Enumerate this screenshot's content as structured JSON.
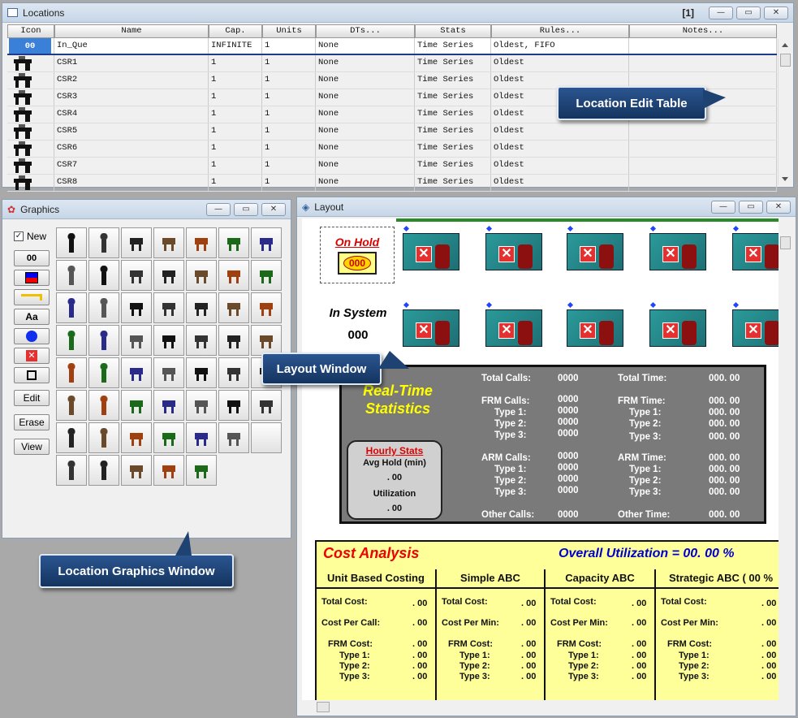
{
  "locations": {
    "title": "Locations",
    "marker": "[1]",
    "columns": [
      "Icon",
      "Name",
      "Cap.",
      "Units",
      "DTs...",
      "Stats",
      "Rules...",
      "Notes..."
    ],
    "rows": [
      {
        "icon": "00",
        "name": "In_Que",
        "cap": "INFINITE",
        "units": "1",
        "dts": "None",
        "stats": "Time Series",
        "rules": "Oldest, FIFO",
        "notes": ""
      },
      {
        "icon": "",
        "name": "CSR1",
        "cap": "1",
        "units": "1",
        "dts": "None",
        "stats": "Time Series",
        "rules": "Oldest",
        "notes": ""
      },
      {
        "icon": "",
        "name": "CSR2",
        "cap": "1",
        "units": "1",
        "dts": "None",
        "stats": "Time Series",
        "rules": "Oldest",
        "notes": ""
      },
      {
        "icon": "",
        "name": "CSR3",
        "cap": "1",
        "units": "1",
        "dts": "None",
        "stats": "Time Series",
        "rules": "Oldest",
        "notes": ""
      },
      {
        "icon": "",
        "name": "CSR4",
        "cap": "1",
        "units": "1",
        "dts": "None",
        "stats": "Time Series",
        "rules": "Oldest",
        "notes": ""
      },
      {
        "icon": "",
        "name": "CSR5",
        "cap": "1",
        "units": "1",
        "dts": "None",
        "stats": "Time Series",
        "rules": "Oldest",
        "notes": ""
      },
      {
        "icon": "",
        "name": "CSR6",
        "cap": "1",
        "units": "1",
        "dts": "None",
        "stats": "Time Series",
        "rules": "Oldest",
        "notes": ""
      },
      {
        "icon": "",
        "name": "CSR7",
        "cap": "1",
        "units": "1",
        "dts": "None",
        "stats": "Time Series",
        "rules": "Oldest",
        "notes": ""
      },
      {
        "icon": "",
        "name": "CSR8",
        "cap": "1",
        "units": "1",
        "dts": "None",
        "stats": "Time Series",
        "rules": "Oldest",
        "notes": ""
      }
    ]
  },
  "graphics": {
    "title": "Graphics",
    "new_label": "New",
    "oo_label": "00",
    "aa_label": "Aa",
    "edit_label": "Edit",
    "erase_label": "Erase",
    "view_label": "View"
  },
  "layout": {
    "title": "Layout",
    "on_hold_label": "On Hold",
    "on_hold_value": "000",
    "in_system_label": "In System",
    "in_system_value": "000",
    "rts": {
      "title_line1": "Real-Time",
      "title_line2": "Statistics",
      "total_calls": "Total Calls:",
      "total_calls_v": "0000",
      "total_time": "Total Time:",
      "total_time_v": "000. 00",
      "frm_calls": "FRM Calls:",
      "frm_calls_v": "0000",
      "frm_time": "FRM Time:",
      "frm_time_v": "000. 00",
      "type1": "Type 1:",
      "type2": "Type 2:",
      "type3": "Type 3:",
      "zero4": "0000",
      "zero_t": "000. 00",
      "arm_calls": "ARM Calls:",
      "arm_calls_v": "0000",
      "arm_time": "ARM Time:",
      "arm_time_v": "000. 00",
      "other_calls": "Other Calls:",
      "other_calls_v": "0000",
      "other_time": "Other Time:",
      "other_time_v": "000. 00",
      "hourly": "Hourly Stats",
      "avg_hold": "Avg Hold (min)",
      "avg_hold_v": ". 00",
      "utilization": "Utilization",
      "utilization_v": ". 00"
    },
    "cost": {
      "title": "Cost Analysis",
      "overall": "Overall Utilization =  00. 00  %",
      "cols": [
        "Unit Based Costing",
        "Simple ABC",
        "Capacity ABC",
        "Strategic ABC (   00   %"
      ],
      "total_cost": "Total Cost:",
      "cost_per_call": "Cost Per Call:",
      "cost_per_min": "Cost Per Min:",
      "frm_cost": "FRM Cost:",
      "type1": "Type 1:",
      "type2": "Type 2:",
      "type3": "Type 3:",
      "val": ". 00"
    }
  },
  "callouts": {
    "location_edit_table": "Location Edit Table",
    "layout_window": "Layout Window",
    "location_graphics_window": "Location Graphics Window"
  }
}
